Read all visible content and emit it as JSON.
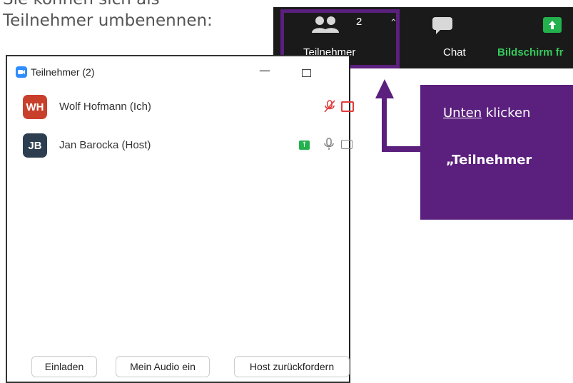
{
  "intro": {
    "line1": "Sie können sich als",
    "line2": "Teilnehmer umbenennen:"
  },
  "toolbar": {
    "participants_label": "Teilnehmer",
    "participants_count": "2",
    "chat_label": "Chat",
    "share_label": "Bildschirm fr",
    "share_color": "#35c95b"
  },
  "panel": {
    "title": "Teilnehmer (2)",
    "participants": [
      {
        "initials": "WH",
        "name": "Wolf Hofmann (Ich)",
        "avatar_color": "#c8402c"
      },
      {
        "initials": "JB",
        "name": "Jan Barocka (Host)",
        "avatar_color": "#2c3e50"
      }
    ],
    "buttons": {
      "invite": "Einladen",
      "audio": "Mein Audio ein",
      "host": "Host zurückfordern"
    }
  },
  "callout": {
    "line1_underlined": "Unten",
    "line1_rest": " klicken",
    "line2": "„Teilnehmer",
    "color": "#5b1f7e"
  }
}
